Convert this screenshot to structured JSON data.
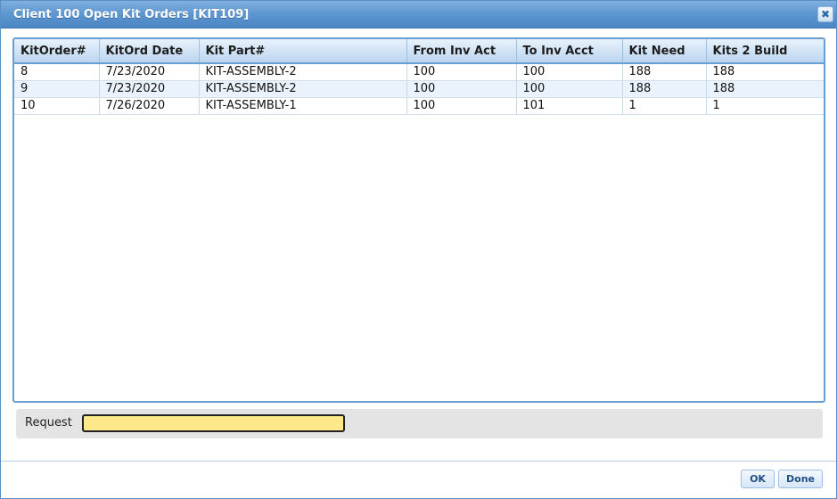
{
  "window": {
    "title": "Client 100 Open Kit Orders [KIT109]",
    "close_symbol": "✖"
  },
  "grid": {
    "columns": [
      "KitOrder#",
      "KitOrd Date",
      "Kit Part#",
      "From Inv Act",
      "To Inv Acct",
      "Kit Need",
      "Kits 2 Build"
    ],
    "rows": [
      [
        "8",
        "7/23/2020",
        "KIT-ASSEMBLY-2",
        "100",
        "100",
        "188",
        "188"
      ],
      [
        "9",
        "7/23/2020",
        "KIT-ASSEMBLY-2",
        "100",
        "100",
        "188",
        "188"
      ],
      [
        "10",
        "7/26/2020",
        "KIT-ASSEMBLY-1",
        "100",
        "101",
        "1",
        "1"
      ]
    ]
  },
  "request": {
    "label": "Request",
    "value": "",
    "highlight_color": "#fde98a"
  },
  "footer": {
    "ok_label": "OK",
    "done_label": "Done"
  },
  "colors": {
    "titlebar": "#5f98d1",
    "grid_border": "#6a9fd2",
    "alt_row": "#eaf2fc"
  }
}
